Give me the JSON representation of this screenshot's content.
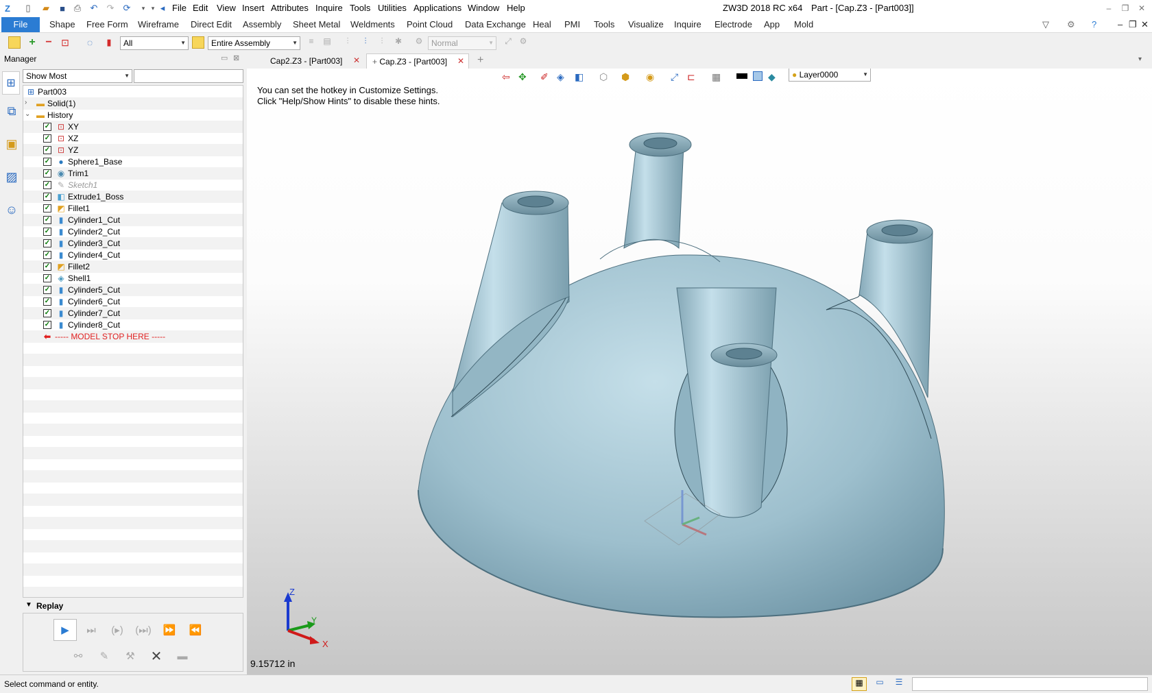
{
  "app": {
    "title": "ZW3D 2018 RC x64",
    "doc_title": "Part - [Cap.Z3 - [Part003]]"
  },
  "menubar": [
    "File",
    "Edit",
    "View",
    "Insert",
    "Attributes",
    "Inquire",
    "Tools",
    "Utilities",
    "Applications",
    "Window",
    "Help"
  ],
  "ribbon": {
    "file_label": "File",
    "tabs": [
      "Shape",
      "Free Form",
      "Wireframe",
      "Direct Edit",
      "Assembly",
      "Sheet Metal",
      "Weldments",
      "Point Cloud",
      "Data Exchange",
      "Heal",
      "PMI",
      "Tools",
      "Visualize",
      "Inquire",
      "Electrode",
      "App",
      "Mold"
    ]
  },
  "toolbar": {
    "filter_value": "All",
    "assembly_value": "Entire Assembly",
    "render_value": "Normal"
  },
  "manager": {
    "title": "Manager",
    "filter_value": "Show Most",
    "tree": [
      {
        "label": "Part003",
        "icon": "part-icon",
        "level": 0
      },
      {
        "label": "Solid(1)",
        "icon": "folder-icon",
        "level": 1,
        "expand": ">"
      },
      {
        "label": "History",
        "icon": "folder-icon",
        "level": 1,
        "expand": "v"
      },
      {
        "label": "XY",
        "icon": "plane-icon",
        "level": 2,
        "checked": true
      },
      {
        "label": "XZ",
        "icon": "plane-icon",
        "level": 2,
        "checked": true
      },
      {
        "label": "YZ",
        "icon": "plane-icon",
        "level": 2,
        "checked": true
      },
      {
        "label": "Sphere1_Base",
        "icon": "sphere-icon",
        "level": 2,
        "checked": true
      },
      {
        "label": "Trim1",
        "icon": "trim-icon",
        "level": 2,
        "checked": true
      },
      {
        "label": "Sketch1",
        "icon": "sketch-icon",
        "level": 2,
        "checked": true,
        "dim": true
      },
      {
        "label": "Extrude1_Boss",
        "icon": "extrude-icon",
        "level": 2,
        "checked": true
      },
      {
        "label": "Fillet1",
        "icon": "fillet-icon",
        "level": 2,
        "checked": true
      },
      {
        "label": "Cylinder1_Cut",
        "icon": "cylinder-icon",
        "level": 2,
        "checked": true
      },
      {
        "label": "Cylinder2_Cut",
        "icon": "cylinder-icon",
        "level": 2,
        "checked": true
      },
      {
        "label": "Cylinder3_Cut",
        "icon": "cylinder-icon",
        "level": 2,
        "checked": true
      },
      {
        "label": "Cylinder4_Cut",
        "icon": "cylinder-icon",
        "level": 2,
        "checked": true
      },
      {
        "label": "Fillet2",
        "icon": "fillet-icon",
        "level": 2,
        "checked": true
      },
      {
        "label": "Shell1",
        "icon": "shell-icon",
        "level": 2,
        "checked": true
      },
      {
        "label": "Cylinder5_Cut",
        "icon": "cylinder-icon",
        "level": 2,
        "checked": true
      },
      {
        "label": "Cylinder6_Cut",
        "icon": "cylinder-icon",
        "level": 2,
        "checked": true
      },
      {
        "label": "Cylinder7_Cut",
        "icon": "cylinder-icon",
        "level": 2,
        "checked": true
      },
      {
        "label": "Cylinder8_Cut",
        "icon": "cylinder-icon",
        "level": 2,
        "checked": true
      }
    ],
    "model_stop": "----- MODEL STOP HERE -----",
    "replay_label": "Replay"
  },
  "tabs": [
    {
      "label": "Cap2.Z3 - [Part003]"
    },
    {
      "label": "Cap.Z3 - [Part003]"
    }
  ],
  "viewport": {
    "hint_line1": "You can set the hotkey in Customize Settings.",
    "hint_line2": "Click \"Help/Show Hints\" to disable these hints.",
    "layer": "Layer0000",
    "measure": "9.15712 in",
    "axis_z": "Z",
    "axis_y": "Y",
    "axis_x": "X"
  },
  "status": {
    "text": "Select command or entity."
  },
  "colors": {
    "accent": "#2b7cd3",
    "model": "#a7c7d4",
    "model_dark": "#6f95a6",
    "red": "#e02020"
  }
}
